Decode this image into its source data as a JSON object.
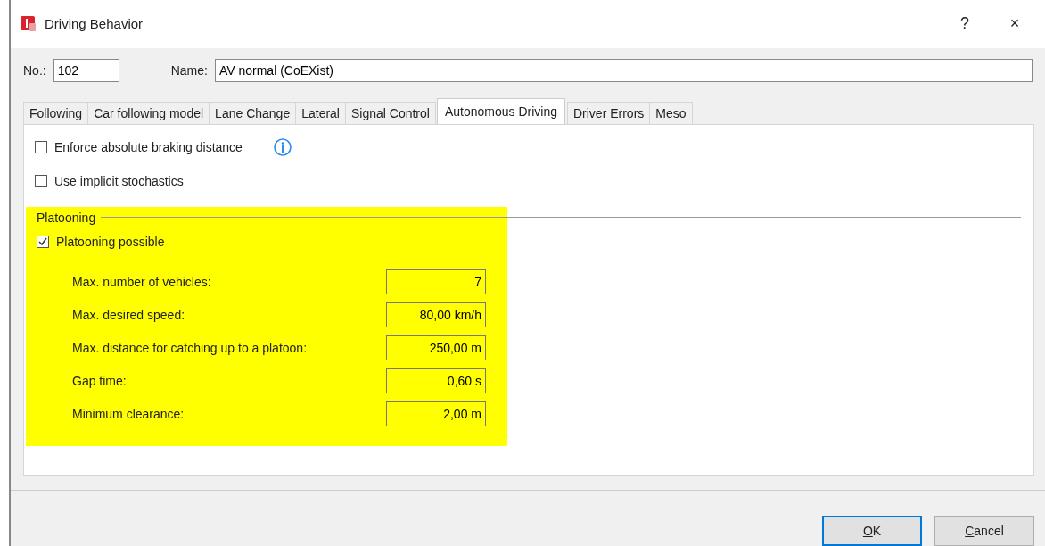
{
  "window": {
    "title": "Driving Behavior",
    "help": "?",
    "close": "×"
  },
  "header": {
    "number_label": "No.:",
    "number": "102",
    "name_label": "Name:",
    "name": "AV normal (CoEXist)"
  },
  "tabs": [
    {
      "label": "Following",
      "selected": false
    },
    {
      "label": "Car following model",
      "selected": false
    },
    {
      "label": "Lane Change",
      "selected": false
    },
    {
      "label": "Lateral",
      "selected": false
    },
    {
      "label": "Signal Control",
      "selected": false
    },
    {
      "label": "Autonomous Driving",
      "selected": true
    },
    {
      "label": "Driver Errors",
      "selected": false
    },
    {
      "label": "Meso",
      "selected": false
    }
  ],
  "options": [
    {
      "label": "Enforce absolute braking distance",
      "checked": false,
      "info": true
    },
    {
      "label": "Use implicit stochastics",
      "checked": false,
      "info": false
    }
  ],
  "platooning": {
    "title": "Platooning",
    "highlighted": true,
    "possible": {
      "label": "Platooning possible",
      "checked": true
    },
    "fields": [
      {
        "label": "Max. number of vehicles:",
        "value": "7"
      },
      {
        "label": "Max. desired speed:",
        "value": "80,00 km/h"
      },
      {
        "label": "Max. distance for catching up to a platoon:",
        "value": "250,00 m"
      },
      {
        "label": "Gap time:",
        "value": "0,60 s"
      },
      {
        "label": "Minimum clearance:",
        "value": "2,00 m"
      }
    ]
  },
  "buttons": [
    {
      "label": "OK",
      "default": true
    },
    {
      "label": "Cancel",
      "default": false
    }
  ]
}
